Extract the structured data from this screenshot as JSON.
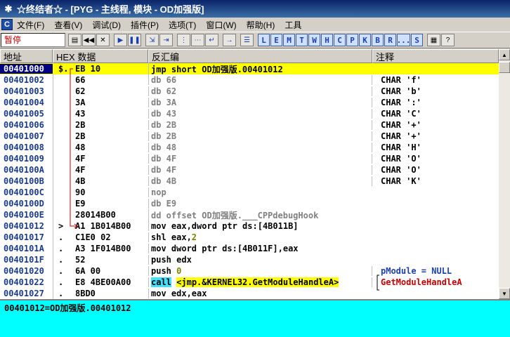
{
  "window": {
    "title": "☆终结者☆ - [PYG -  主线程, 模块 - OD加强版]"
  },
  "menu": [
    "文件(F)",
    "查看(V)",
    "调试(D)",
    "插件(P)",
    "选项(T)",
    "窗口(W)",
    "帮助(H)",
    "工具"
  ],
  "toolbar": {
    "status": "暂停",
    "buttons": [
      "open-icon",
      "rewind-icon",
      "close-icon",
      "play-icon",
      "pause-icon",
      "step-into-icon",
      "step-over-icon",
      "trace-into-icon",
      "trace-over-icon",
      "execute-till-return-icon",
      "goto-icon",
      "list-icon"
    ],
    "letters": [
      "L",
      "E",
      "M",
      "T",
      "W",
      "H",
      "C",
      "P",
      "K",
      "B",
      "R",
      "...",
      "S"
    ]
  },
  "columns": {
    "address": "地址",
    "hex": "HEX 数据",
    "disasm": "反汇编",
    "comment": "注释"
  },
  "rows": [
    {
      "addr": "00401000",
      "mark": "$.",
      "hex": "EB 10",
      "dis": "jmp short OD加强版.00401012",
      "com": ""
    },
    {
      "addr": "00401002",
      "mark": "",
      "hex": "66",
      "dis": "db 66",
      "com": "CHAR 'f'"
    },
    {
      "addr": "00401003",
      "mark": "",
      "hex": "62",
      "dis": "db 62",
      "com": "CHAR 'b'"
    },
    {
      "addr": "00401004",
      "mark": "",
      "hex": "3A",
      "dis": "db 3A",
      "com": "CHAR ':'"
    },
    {
      "addr": "00401005",
      "mark": "",
      "hex": "43",
      "dis": "db 43",
      "com": "CHAR 'C'"
    },
    {
      "addr": "00401006",
      "mark": "",
      "hex": "2B",
      "dis": "db 2B",
      "com": "CHAR '+'"
    },
    {
      "addr": "00401007",
      "mark": "",
      "hex": "2B",
      "dis": "db 2B",
      "com": "CHAR '+'"
    },
    {
      "addr": "00401008",
      "mark": "",
      "hex": "48",
      "dis": "db 48",
      "com": "CHAR 'H'"
    },
    {
      "addr": "00401009",
      "mark": "",
      "hex": "4F",
      "dis": "db 4F",
      "com": "CHAR 'O'"
    },
    {
      "addr": "0040100A",
      "mark": "",
      "hex": "4F",
      "dis": "db 4F",
      "com": "CHAR 'O'"
    },
    {
      "addr": "0040100B",
      "mark": "",
      "hex": "4B",
      "dis": "db 4B",
      "com": "CHAR 'K'"
    },
    {
      "addr": "0040100C",
      "mark": "",
      "hex": "90",
      "dis": "nop",
      "com": ""
    },
    {
      "addr": "0040100D",
      "mark": "",
      "hex": "E9",
      "dis": "db E9",
      "com": ""
    },
    {
      "addr": "0040100E",
      "mark": "",
      "hex": "28014B00",
      "dis": "dd offset OD加强版.___CPPdebugHook",
      "com": ""
    },
    {
      "addr": "00401012",
      "mark": ">",
      "hex": "A1 1B014B00",
      "dis": "mov eax,dword ptr ds:[4B011B]",
      "com": ""
    },
    {
      "addr": "00401017",
      "mark": ".",
      "hex": "C1E0 02",
      "dis_a": "shl eax,",
      "dis_num": "2",
      "com": ""
    },
    {
      "addr": "0040101A",
      "mark": ".",
      "hex": "A3 1F014B00",
      "dis": "mov dword ptr ds:[4B011F],eax",
      "com": ""
    },
    {
      "addr": "0040101F",
      "mark": ".",
      "hex": "52",
      "dis": "push edx",
      "com": ""
    },
    {
      "addr": "00401020",
      "mark": ".",
      "hex": "6A 00",
      "dis_a": "push ",
      "dis_num": "0",
      "com": "pModule = NULL"
    },
    {
      "addr": "00401022",
      "mark": ".",
      "hex": "E8 4BE00A00",
      "dis_call": "call",
      "dis_target": "<jmp.&KERNEL32.GetModuleHandleA>",
      "com": "GetModuleHandleA"
    },
    {
      "addr": "00401027",
      "mark": ".",
      "hex": "8BD0",
      "dis": "mov edx,eax",
      "com": ""
    }
  ],
  "info": "00401012=OD加强版.00401012"
}
